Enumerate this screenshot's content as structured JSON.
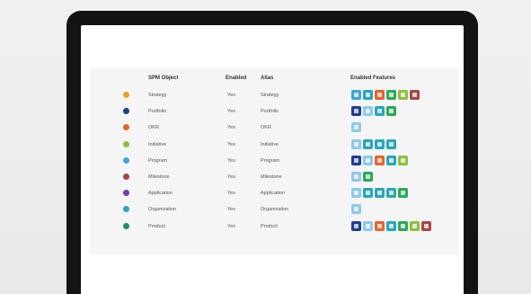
{
  "table": {
    "headers": {
      "object": "SPM Object",
      "enabled": "Enabled",
      "alias": "Alias",
      "features": "Enabled Features"
    },
    "rows": [
      {
        "name": "Strategy",
        "enabled": "Yes",
        "alias": "Strategy",
        "dot_color": "#f0a020",
        "features": [
          "f-sky",
          "f-teal",
          "f-orange",
          "f-green",
          "f-lime",
          "f-red"
        ]
      },
      {
        "name": "Portfolio",
        "enabled": "Yes",
        "alias": "Portfolio",
        "dot_color": "#1f3f8f",
        "features": [
          "f-navy",
          "f-light",
          "f-teal",
          "f-green"
        ]
      },
      {
        "name": "OKR",
        "enabled": "Yes",
        "alias": "OKR",
        "dot_color": "#e8642b",
        "features": [
          "f-light"
        ]
      },
      {
        "name": "Initiative",
        "enabled": "Yes",
        "alias": "Initiative",
        "dot_color": "#8fbe43",
        "features": [
          "f-light",
          "f-teal",
          "f-teal",
          "f-teal"
        ]
      },
      {
        "name": "Program",
        "enabled": "Yes",
        "alias": "Program",
        "dot_color": "#39a8d7",
        "features": [
          "f-navy",
          "f-light",
          "f-orange",
          "f-teal",
          "f-lime"
        ]
      },
      {
        "name": "Milestone",
        "enabled": "Yes",
        "alias": "Milestone",
        "dot_color": "#a8454a",
        "features": [
          "f-light",
          "f-green"
        ]
      },
      {
        "name": "Application",
        "enabled": "Yes",
        "alias": "Application",
        "dot_color": "#6a3fa8",
        "features": [
          "f-light",
          "f-teal",
          "f-teal",
          "f-teal",
          "f-green"
        ]
      },
      {
        "name": "Organization",
        "enabled": "Yes",
        "alias": "Organization",
        "dot_color": "#2aa6b8",
        "features": [
          "f-light"
        ]
      },
      {
        "name": "Product",
        "enabled": "Yes",
        "alias": "Product",
        "dot_color": "#1f8f6a",
        "features": [
          "f-navy",
          "f-light",
          "f-orange",
          "f-teal",
          "f-green",
          "f-lime",
          "f-red"
        ]
      }
    ]
  }
}
